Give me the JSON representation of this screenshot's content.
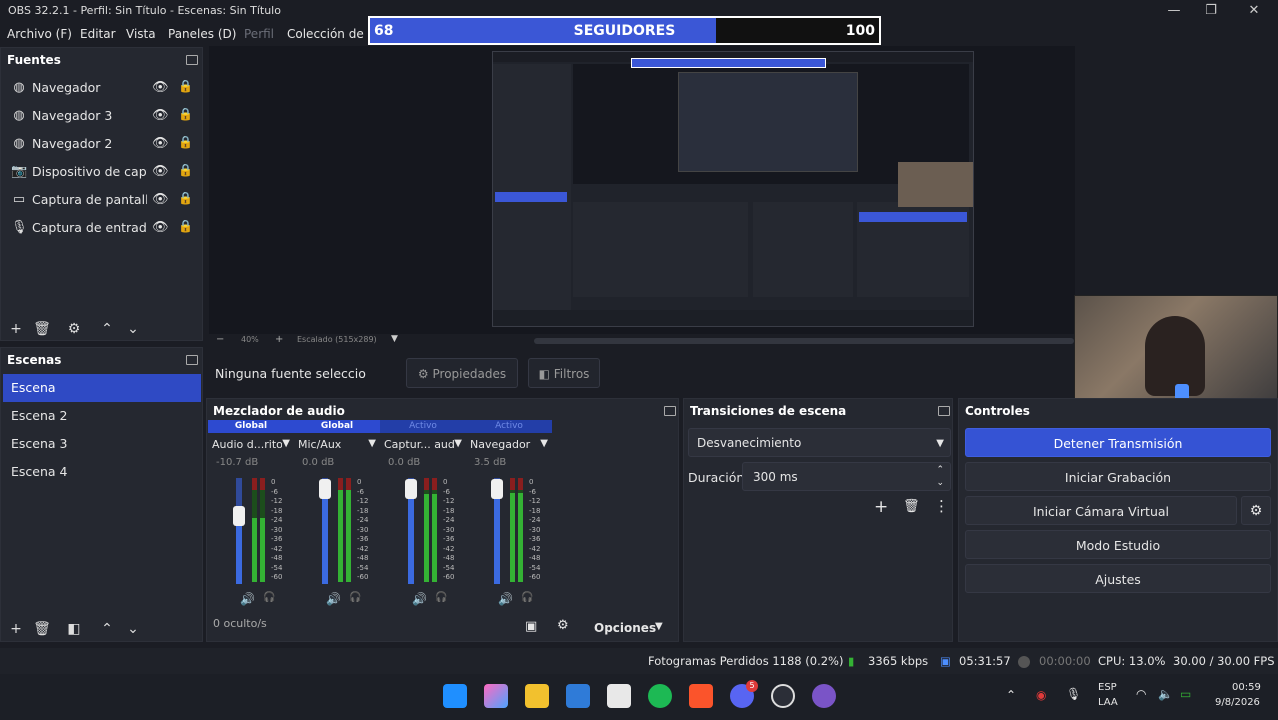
{
  "window": {
    "title": "OBS 32.2.1 - Perfil: Sin Título - Escenas: Sin Título"
  },
  "menu": {
    "items": [
      "Archivo (F)",
      "Editar",
      "Vista",
      "Paneles (D)",
      "Perfil",
      "Colección de E"
    ]
  },
  "overlay": {
    "left_value": "68",
    "label": "SEGUIDORES",
    "right_value": "100",
    "progress": 0.68
  },
  "sources": {
    "title": "Fuentes",
    "items": [
      {
        "icon": "globe-icon",
        "label": "Navegador"
      },
      {
        "icon": "globe-icon",
        "label": "Navegador 3"
      },
      {
        "icon": "globe-icon",
        "label": "Navegador 2"
      },
      {
        "icon": "camera-icon",
        "label": "Dispositivo de captura de video"
      },
      {
        "icon": "monitor-icon",
        "label": "Captura de pantalla"
      },
      {
        "icon": "microphone-icon",
        "label": "Captura de entrada de audio"
      }
    ]
  },
  "scenes": {
    "title": "Escenas",
    "items": [
      "Escena",
      "Escena 2",
      "Escena 3",
      "Escena 4"
    ],
    "selected": 0
  },
  "preview": {
    "zoom": "40%",
    "scale": "Escalado (515x289)"
  },
  "context": {
    "no_source": "Ninguna fuente seleccionada",
    "properties": "Propiedades",
    "filters": "Filtros"
  },
  "mixer": {
    "title": "Mezclador de audio",
    "hidden": "0 oculto/s",
    "options": "Opciones",
    "channels": [
      {
        "badge": "Global",
        "active": false,
        "name": "Audio d...ritorio",
        "db": "-10.7 dB",
        "level": 0.62,
        "fader": 0.64
      },
      {
        "badge": "Global",
        "active": false,
        "name": "Mic/Aux",
        "db": "0.0 dB",
        "level": 0.88,
        "fader": 0.9
      },
      {
        "badge": "Activo",
        "active": true,
        "name": "Captur... audio",
        "db": "0.0 dB",
        "level": 0.85,
        "fader": 0.9
      },
      {
        "badge": "Activo",
        "active": true,
        "name": "Navegador",
        "db": "3.5 dB",
        "level": 0.86,
        "fader": 0.9
      }
    ],
    "ticks": [
      "0",
      "-6",
      "-12",
      "-18",
      "-24",
      "-30",
      "-36",
      "-42",
      "-48",
      "-54",
      "-60"
    ]
  },
  "transitions": {
    "title": "Transiciones de escena",
    "selected": "Desvanecimiento",
    "duration_label": "Duración",
    "duration_value": "300 ms"
  },
  "controls": {
    "title": "Controles",
    "buttons": [
      "Detener Transmisión",
      "Iniciar Grabación",
      "Iniciar Cámara Virtual",
      "Modo Estudio",
      "Ajustes"
    ]
  },
  "status": {
    "dropped": "Fotogramas Perdidos 1188 (0.2%)",
    "bitrate": "3365 kbps",
    "stream_time": "05:31:57",
    "rec_time": "00:00:00",
    "cpu": "CPU: 13.0%",
    "fps": "30.00 / 30.00 FPS"
  },
  "taskbar": {
    "lang1": "ESP",
    "lang2": "LAA",
    "time": "00:59",
    "date": "9/8/2026",
    "badge": "5"
  }
}
